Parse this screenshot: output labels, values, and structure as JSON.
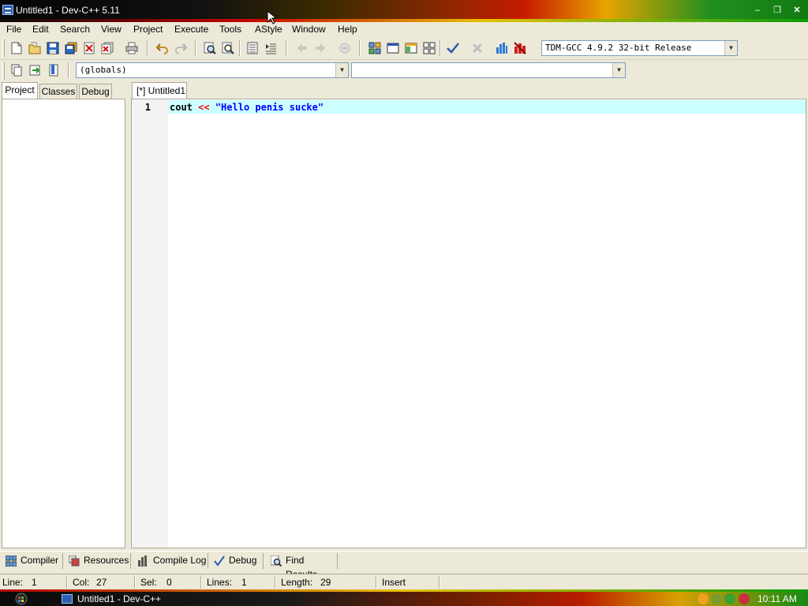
{
  "window": {
    "title": "Untitled1 - Dev-C++ 5.11",
    "minimize": "–",
    "maximize": "❐",
    "close": "✕"
  },
  "menu": [
    "File",
    "Edit",
    "Search",
    "View",
    "Project",
    "Execute",
    "Tools",
    "AStyle",
    "Window",
    "Help"
  ],
  "toolbar": {
    "compiler_select": "TDM-GCC 4.9.2 32-bit Release",
    "scope_select": "(globals)",
    "function_select": ""
  },
  "left_tabs": [
    "Project",
    "Classes",
    "Debug"
  ],
  "editor": {
    "tab_label": "[*] Untitled1",
    "line_number": "1",
    "code": {
      "kw": "cout",
      "op": "<<",
      "str": "\"Hello penis sucke\""
    }
  },
  "bottom_tabs": [
    "Compiler",
    "Resources",
    "Compile Log",
    "Debug",
    "Find Results"
  ],
  "status": {
    "line_label": "Line:",
    "line_value": "1",
    "col_label": "Col:",
    "col_value": "27",
    "sel_label": "Sel:",
    "sel_value": "0",
    "lines_label": "Lines:",
    "lines_value": "1",
    "length_label": "Length:",
    "length_value": "29",
    "mode": "Insert"
  },
  "taskbar": {
    "item": "Untitled1 - Dev-C++",
    "clock": "10:11 AM"
  },
  "colors": {
    "keyword": "#000000",
    "operator": "#ff0000",
    "string": "#0000ff",
    "active_line": "#ccffff"
  }
}
